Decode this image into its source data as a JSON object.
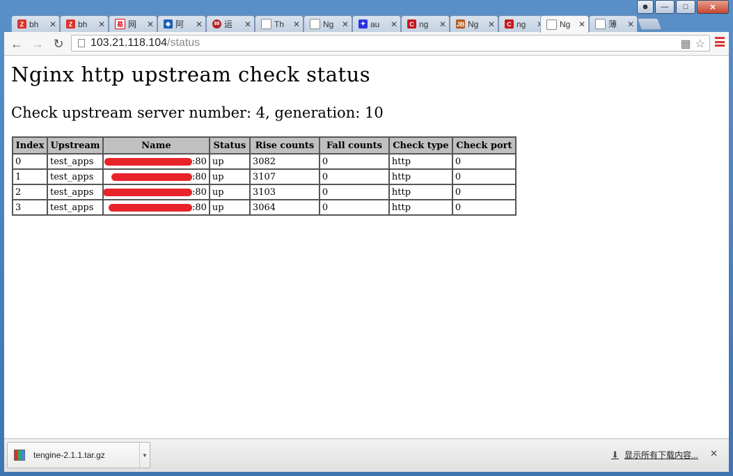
{
  "tabs": [
    {
      "label": "bh",
      "icon": "red-z-icon",
      "color": "#d9342b"
    },
    {
      "label": "bh",
      "icon": "red-z-icon",
      "color": "#d9342b"
    },
    {
      "label": "网",
      "icon": "netease-icon",
      "color": "#d7000f"
    },
    {
      "label": "阿",
      "icon": "aliyun-icon",
      "color": "#1b5fb3"
    },
    {
      "label": "运",
      "icon": "circle-89-icon",
      "color": "#b22222"
    },
    {
      "label": "Th",
      "icon": "page-icon",
      "color": "#888888"
    },
    {
      "label": "Ng",
      "icon": "page-icon",
      "color": "#888888"
    },
    {
      "label": "au",
      "icon": "baidu-paw-icon",
      "color": "#2932e1"
    },
    {
      "label": "ng",
      "icon": "red-c-icon",
      "color": "#c8161d"
    },
    {
      "label": "Ng",
      "icon": "jb-icon",
      "color": "#b45a1e"
    },
    {
      "label": "ng",
      "icon": "red-c-icon",
      "color": "#c8161d"
    },
    {
      "label": "Ng",
      "icon": "page-icon",
      "color": "#888888",
      "active": true
    },
    {
      "label": "薄",
      "icon": "page-icon",
      "color": "#888888"
    }
  ],
  "address": {
    "host": "103.21.118.104",
    "path": "/status"
  },
  "page": {
    "title": "Nginx http upstream check status",
    "subtitle": "Check upstream server number: 4, generation: 10"
  },
  "table": {
    "headers": [
      "Index",
      "Upstream",
      "Name",
      "Status",
      "Rise counts",
      "Fall counts",
      "Check type",
      "Check port"
    ],
    "rows": [
      {
        "index": "0",
        "upstream": "test_apps",
        "name_suffix": ":80",
        "status": "up",
        "rise": "3082",
        "fall": "0",
        "type": "http",
        "port": "0"
      },
      {
        "index": "1",
        "upstream": "test_apps",
        "name_suffix": ":80",
        "status": "up",
        "rise": "3107",
        "fall": "0",
        "type": "http",
        "port": "0"
      },
      {
        "index": "2",
        "upstream": "test_apps",
        "name_suffix": ":80",
        "status": "up",
        "rise": "3103",
        "fall": "0",
        "type": "http",
        "port": "0"
      },
      {
        "index": "3",
        "upstream": "test_apps",
        "name_suffix": ":80",
        "status": "up",
        "rise": "3064",
        "fall": "0",
        "type": "http",
        "port": "0"
      }
    ]
  },
  "downloads": {
    "file": "tengine-2.1.1.tar.gz",
    "show_all": "显示所有下载内容..."
  },
  "colors": {
    "redaction": "#e8242b",
    "table_header_bg": "#c0c0c0"
  }
}
